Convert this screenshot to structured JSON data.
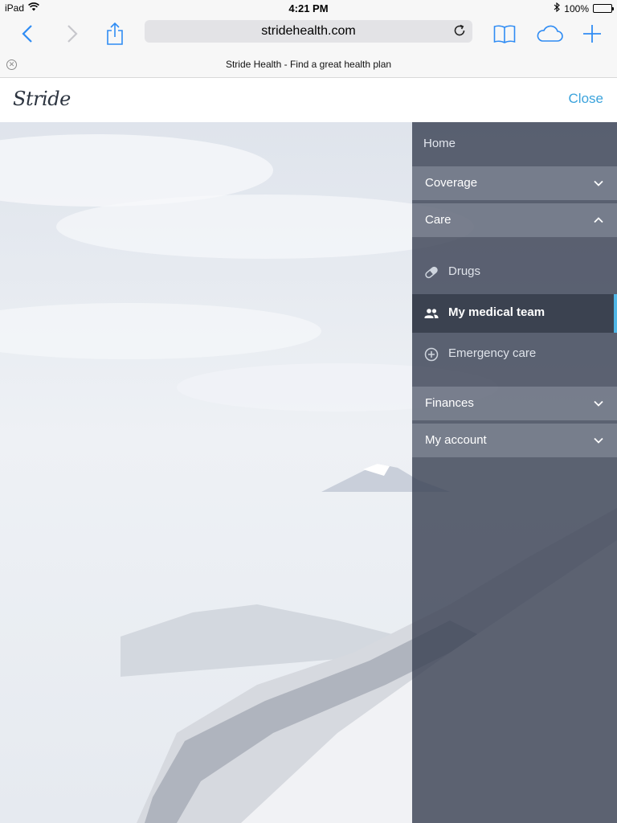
{
  "status_bar": {
    "device": "iPad",
    "time": "4:21 PM",
    "battery": "100%",
    "battery_level": 1.0
  },
  "browser": {
    "url": "stridehealth.com",
    "tab_title": "Stride Health - Find a great health plan"
  },
  "site": {
    "logo": "Stride",
    "close_label": "Close"
  },
  "menu": {
    "home": "Home",
    "sections": [
      {
        "label": "Coverage",
        "expanded": false
      },
      {
        "label": "Care",
        "expanded": true
      },
      {
        "label": "Finances",
        "expanded": false
      },
      {
        "label": "My account",
        "expanded": false
      }
    ],
    "care_items": [
      {
        "label": "Drugs",
        "icon": "pill-icon",
        "active": false
      },
      {
        "label": "My medical team",
        "icon": "people-icon",
        "active": true
      },
      {
        "label": "Emergency care",
        "icon": "plus-circle-icon",
        "active": false
      }
    ]
  },
  "colors": {
    "accent": "#3ba3dc",
    "active_indicator": "#4fb6e6",
    "menu_bg": "#3a4254"
  }
}
